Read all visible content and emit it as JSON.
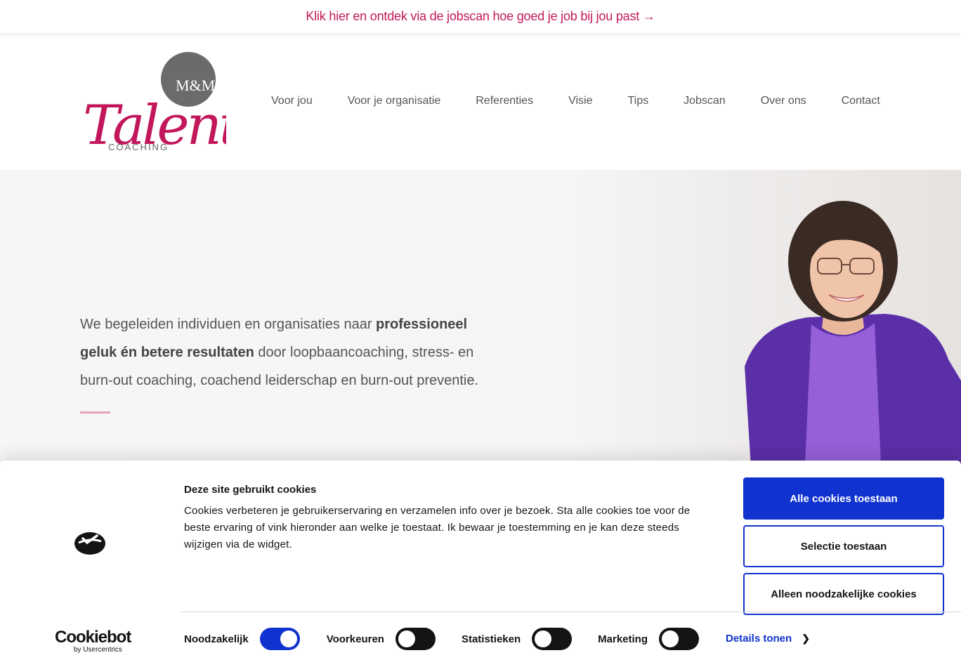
{
  "announcement": {
    "text": "Klik hier en ontdek via de jobscan hoe goed je job bij jou past →"
  },
  "logo": {
    "monogram": "M&M",
    "script": "Talent",
    "sub": "COACHING"
  },
  "nav": {
    "items": [
      {
        "label": "Voor jou"
      },
      {
        "label": "Voor je organisatie"
      },
      {
        "label": "Referenties"
      },
      {
        "label": "Visie"
      },
      {
        "label": "Tips"
      },
      {
        "label": "Jobscan"
      },
      {
        "label": "Over ons"
      },
      {
        "label": "Contact"
      }
    ]
  },
  "hero": {
    "part1": "We begeleiden individuen en organisaties naar ",
    "bold1": "professioneel geluk én betere resultaten",
    "part2": " door loopbaancoaching, stress- en burn-out coaching, coachend leiderschap en burn-out preventie."
  },
  "cookie": {
    "title": "Deze site gebruikt cookies",
    "text": "Cookies verbeteren je gebruikerservaring en verzamelen info over je bezoek. Sta alle cookies toe voor de beste ervaring of vink hieronder aan welke je toestaat. Ik bewaar je toestemming en je kan deze steeds wijzigen via de widget.",
    "allow_all": "Alle cookies toestaan",
    "allow_selection": "Selectie toestaan",
    "necessary_only": "Alleen noodzakelijke cookies",
    "brand_name": "Cookiebot",
    "brand_by": "by Usercentrics",
    "toggles": [
      {
        "label": "Noodzakelijk",
        "on": true
      },
      {
        "label": "Voorkeuren",
        "on": false
      },
      {
        "label": "Statistieken",
        "on": false
      },
      {
        "label": "Marketing",
        "on": false
      }
    ],
    "details": "Details tonen"
  },
  "colors": {
    "brand_pink": "#c2185b",
    "cookie_blue": "#1032cf",
    "logo_grey": "#6b6b6b"
  }
}
